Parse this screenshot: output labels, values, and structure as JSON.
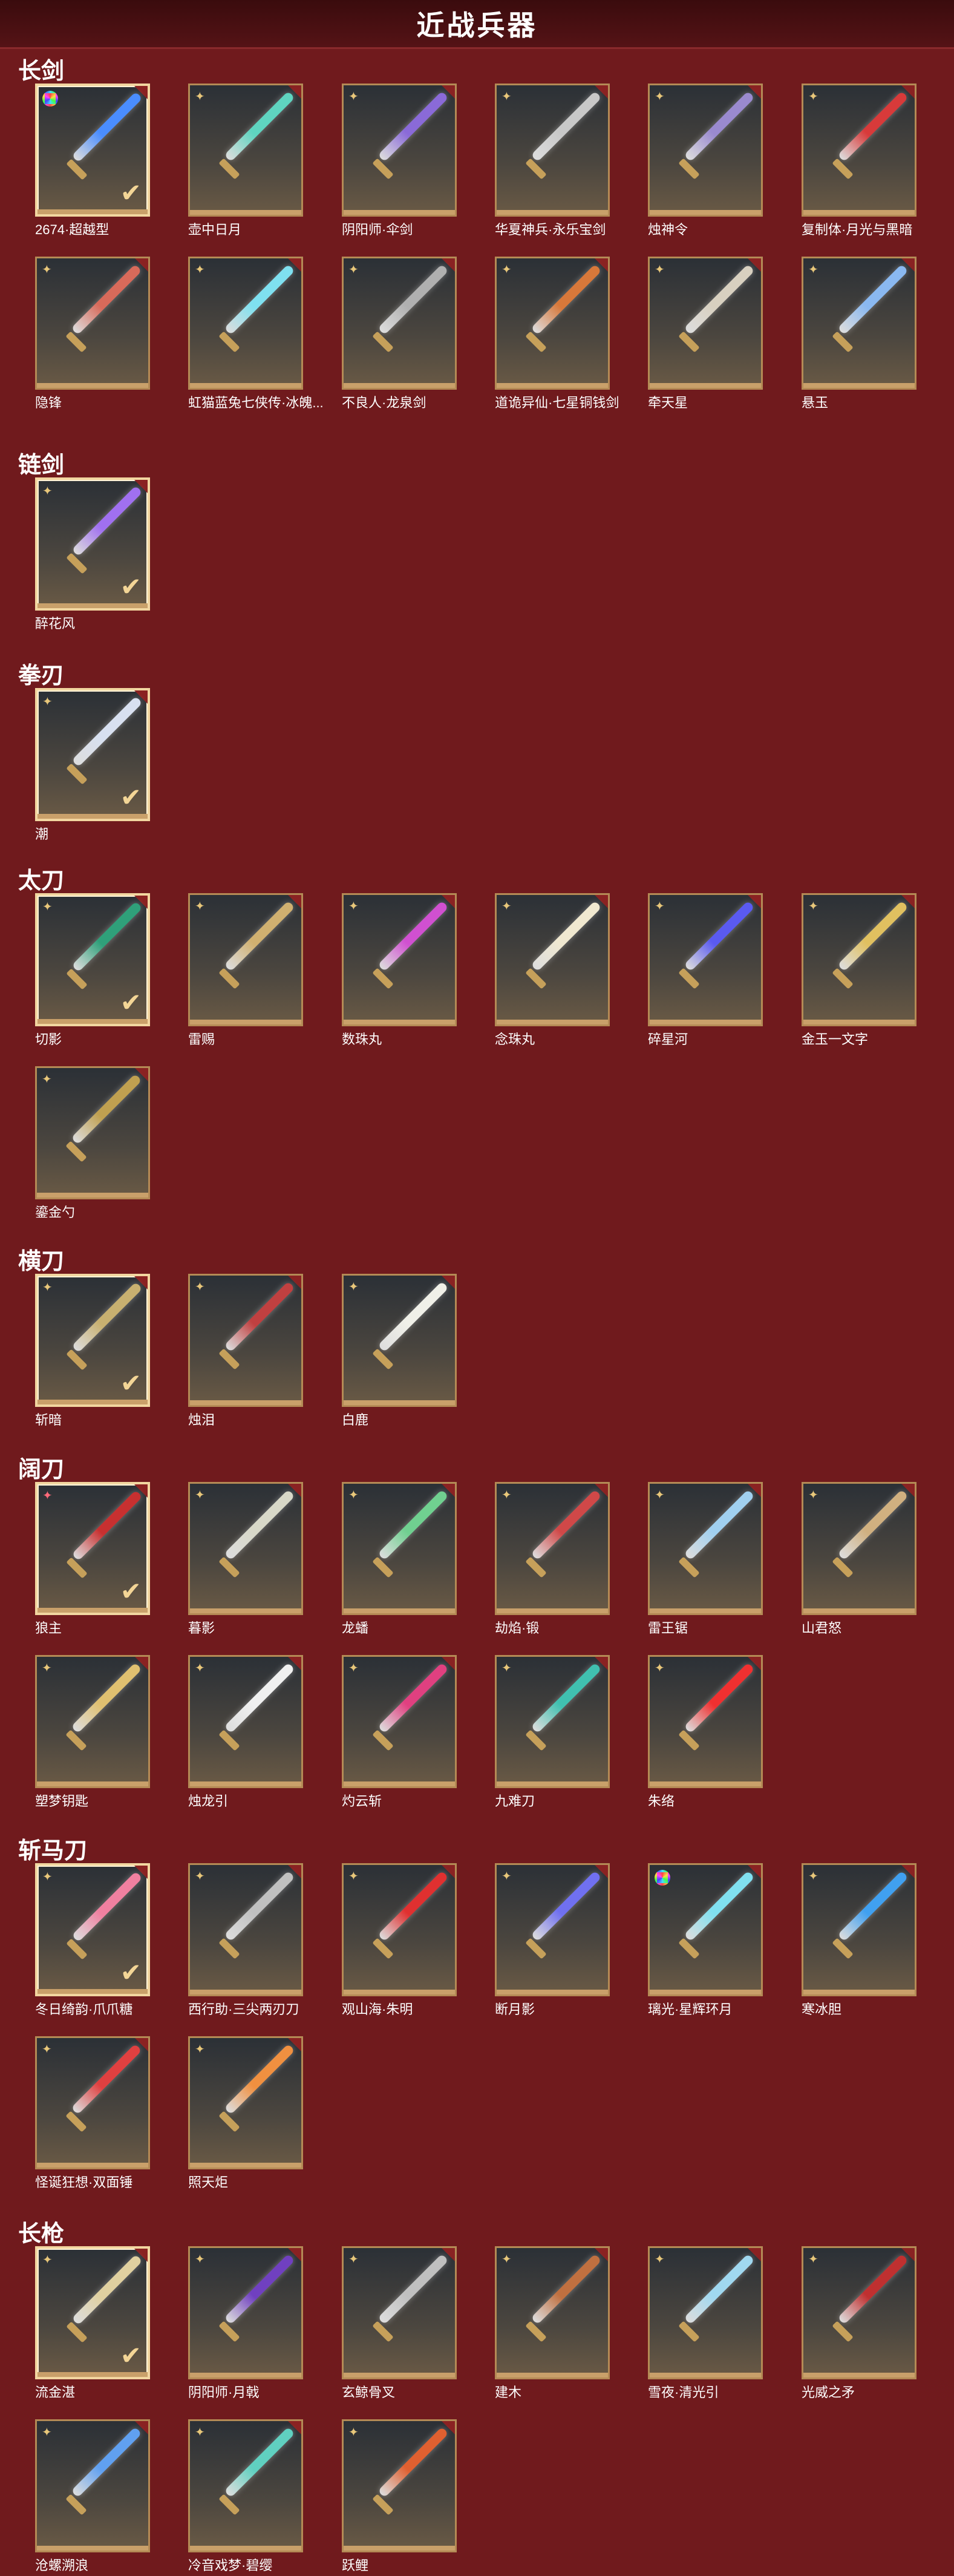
{
  "page_title": "近战兵器",
  "sections": [
    {
      "name": "长剑",
      "items": [
        {
          "label": "2674·超越型",
          "badge": "ring-icon",
          "selected": true,
          "color": "#4a8dff"
        },
        {
          "label": "壶中日月",
          "badge": "sparkle-icon",
          "selected": false,
          "color": "#5fd4c0"
        },
        {
          "label": "阴阳师·伞剑",
          "badge": "sparkle-icon",
          "selected": false,
          "color": "#8a6ad8"
        },
        {
          "label": "华夏神兵·永乐宝剑",
          "badge": "sparkle-icon",
          "selected": false,
          "color": "#c8c8c8"
        },
        {
          "label": "烛神令",
          "badge": "sparkle-icon",
          "selected": false,
          "color": "#9a8acf"
        },
        {
          "label": "复制体·月光与黑暗",
          "badge": "sparkle-icon",
          "selected": false,
          "color": "#d83a3a"
        },
        {
          "label": "隐锋",
          "badge": "sparkle-icon",
          "selected": false,
          "color": "#d86a5a"
        },
        {
          "label": "虹猫蓝兔七侠传·冰魄...",
          "badge": "sparkle-icon",
          "selected": false,
          "color": "#7fe0f0"
        },
        {
          "label": "不良人·龙泉剑",
          "badge": "sparkle-icon",
          "selected": false,
          "color": "#b0b0b0"
        },
        {
          "label": "道诡异仙·七星铜钱剑",
          "badge": "sparkle-icon",
          "selected": false,
          "color": "#d8783a"
        },
        {
          "label": "牵天星",
          "badge": "sparkle-icon",
          "selected": false,
          "color": "#d8d0c0"
        },
        {
          "label": "悬玉",
          "badge": "sparkle-icon",
          "selected": false,
          "color": "#8ab8f0"
        }
      ]
    },
    {
      "name": "链剑",
      "items": [
        {
          "label": "醉花风",
          "badge": "sparkle-icon",
          "selected": true,
          "color": "#a070f0"
        }
      ]
    },
    {
      "name": "拳刃",
      "items": [
        {
          "label": "潮",
          "badge": "sparkle-icon",
          "selected": true,
          "color": "#d8e0f0"
        }
      ]
    },
    {
      "name": "太刀",
      "items": [
        {
          "label": "切影",
          "badge": "sparkle-icon",
          "selected": true,
          "color": "#2fa07a"
        },
        {
          "label": "雷赐",
          "badge": "sparkle-icon",
          "selected": false,
          "color": "#d0b070"
        },
        {
          "label": "数珠丸",
          "badge": "sparkle-icon",
          "selected": false,
          "color": "#d050d0"
        },
        {
          "label": "念珠丸",
          "badge": "sparkle-icon",
          "selected": false,
          "color": "#f0e8d0"
        },
        {
          "label": "碎星河",
          "badge": "sparkle-icon",
          "selected": false,
          "color": "#5a5af0"
        },
        {
          "label": "金玉一文字",
          "badge": "sparkle-icon",
          "selected": false,
          "color": "#e0c060"
        },
        {
          "label": "鎏金勺",
          "badge": "sparkle-icon",
          "selected": false,
          "color": "#c0a050"
        }
      ]
    },
    {
      "name": "横刀",
      "items": [
        {
          "label": "斩暗",
          "badge": "sparkle-icon",
          "selected": true,
          "color": "#c8b070"
        },
        {
          "label": "烛泪",
          "badge": "sparkle-icon",
          "selected": false,
          "color": "#c04040"
        },
        {
          "label": "白鹿",
          "badge": "sparkle-icon",
          "selected": false,
          "color": "#f0f0e8"
        }
      ]
    },
    {
      "name": "阔刀",
      "items": [
        {
          "label": "狼主",
          "badge": "pink-star-icon",
          "selected": true,
          "color": "#c83030"
        },
        {
          "label": "暮影",
          "badge": "sparkle-icon",
          "selected": false,
          "color": "#d8d8c8"
        },
        {
          "label": "龙蟠",
          "badge": "sparkle-icon",
          "selected": false,
          "color": "#70d090"
        },
        {
          "label": "劫焰·锻",
          "badge": "sparkle-icon",
          "selected": false,
          "color": "#d04848"
        },
        {
          "label": "雷王锯",
          "badge": "sparkle-icon",
          "selected": false,
          "color": "#a0d0f0"
        },
        {
          "label": "山君怒",
          "badge": "sparkle-icon",
          "selected": false,
          "color": "#d0b080"
        },
        {
          "label": "塑梦钥匙",
          "badge": "sparkle-icon",
          "selected": false,
          "color": "#e0c070"
        },
        {
          "label": "烛龙引",
          "badge": "sparkle-icon",
          "selected": false,
          "color": "#f0f0f0"
        },
        {
          "label": "灼云斩",
          "badge": "sparkle-icon",
          "selected": false,
          "color": "#e04080"
        },
        {
          "label": "九难刀",
          "badge": "sparkle-icon",
          "selected": false,
          "color": "#40c0b0"
        },
        {
          "label": "朱络",
          "badge": "sparkle-icon",
          "selected": false,
          "color": "#f03030"
        }
      ]
    },
    {
      "name": "斩马刀",
      "items": [
        {
          "label": "冬日绮韵·爪爪糖",
          "badge": "sparkle-icon",
          "selected": true,
          "color": "#f080a0"
        },
        {
          "label": "西行助·三尖两刃刀",
          "badge": "sparkle-icon",
          "selected": false,
          "color": "#c0c0c0"
        },
        {
          "label": "观山海·朱明",
          "badge": "sparkle-icon",
          "selected": false,
          "color": "#e03030"
        },
        {
          "label": "断月影",
          "badge": "sparkle-icon",
          "selected": false,
          "color": "#7070f0"
        },
        {
          "label": "璃光·星辉环月",
          "badge": "ring-icon",
          "selected": false,
          "color": "#80e0f0"
        },
        {
          "label": "寒冰胆",
          "badge": "sparkle-icon",
          "selected": false,
          "color": "#40a0f0"
        },
        {
          "label": "怪诞狂想·双面锤",
          "badge": "sparkle-icon",
          "selected": false,
          "color": "#e04040"
        },
        {
          "label": "照天炬",
          "badge": "sparkle-icon",
          "selected": false,
          "color": "#f09040"
        }
      ]
    },
    {
      "name": "长枪",
      "items": [
        {
          "label": "流金湛",
          "badge": "sparkle-icon",
          "selected": true,
          "color": "#e0d0a0"
        },
        {
          "label": "阴阳师·月戟",
          "badge": "sparkle-icon",
          "selected": false,
          "color": "#7040c0"
        },
        {
          "label": "玄鲸骨叉",
          "badge": "sparkle-icon",
          "selected": false,
          "color": "#c0c0c0"
        },
        {
          "label": "建木",
          "badge": "sparkle-icon",
          "selected": false,
          "color": "#c07040"
        },
        {
          "label": "雪夜·清光引",
          "badge": "sparkle-icon",
          "selected": false,
          "color": "#a0d8f0"
        },
        {
          "label": "光威之矛",
          "badge": "sparkle-icon",
          "selected": false,
          "color": "#c03030"
        },
        {
          "label": "沧螺溯浪",
          "badge": "sparkle-icon",
          "selected": false,
          "color": "#60a0f0"
        },
        {
          "label": "冷音戏梦·碧缨",
          "badge": "sparkle-icon",
          "selected": false,
          "color": "#60d0c0"
        },
        {
          "label": "跃鲤",
          "badge": "sparkle-icon",
          "selected": false,
          "color": "#e06030"
        }
      ]
    }
  ]
}
